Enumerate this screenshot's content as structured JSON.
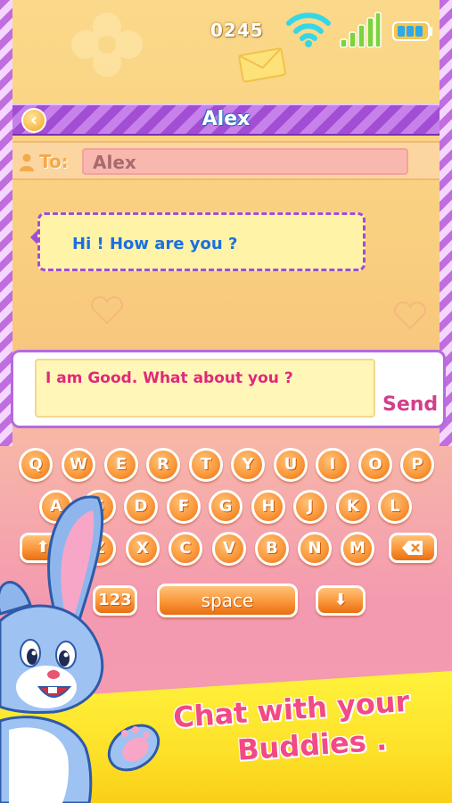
{
  "status": {
    "time": "0245"
  },
  "header": {
    "title": "Alex"
  },
  "to": {
    "label": "To:",
    "value": "Alex"
  },
  "messages": [
    {
      "text": "Hi ! How are you ?"
    }
  ],
  "compose": {
    "text": "I am Good. What about you ?",
    "send_label": "Send"
  },
  "keyboard": {
    "row1": [
      "Q",
      "W",
      "E",
      "R",
      "T",
      "Y",
      "U",
      "I",
      "O",
      "P"
    ],
    "row2": [
      "A",
      "S",
      "D",
      "F",
      "G",
      "H",
      "J",
      "K",
      "L"
    ],
    "row3": [
      "Z",
      "X",
      "C",
      "V",
      "B",
      "N",
      "M"
    ],
    "numbers_label": "123",
    "space_label": "space"
  },
  "banner": {
    "line1": "Chat with your",
    "line2": "Buddies ."
  },
  "colors": {
    "accent_purple": "#a14ed4",
    "key_orange": "#fb9a3e",
    "banner_yellow": "#fde12a",
    "banner_text": "#f24a86"
  },
  "icons": [
    "wifi-icon",
    "signal-icon",
    "battery-icon",
    "envelope-icon",
    "back-arrow-icon",
    "person-icon",
    "shift-icon",
    "backspace-icon",
    "hide-keyboard-icon",
    "bunny-mascot"
  ]
}
